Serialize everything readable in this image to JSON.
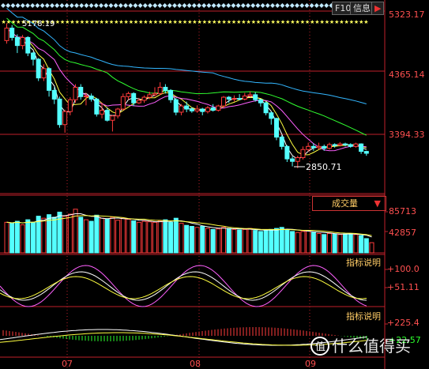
{
  "toolbar": {
    "f10_label": "F10",
    "info_label": "信息",
    "expand_icon": "expand-right-icon"
  },
  "price_axis": {
    "labels": [
      "5323.17",
      "4365.14",
      "3394.33"
    ]
  },
  "volume": {
    "title": "成交量",
    "axis_labels": [
      "85713",
      "42857"
    ]
  },
  "indicator1": {
    "label": "指标说明",
    "axis_labels": [
      "+100.0",
      "+51.11"
    ]
  },
  "indicator2": {
    "label": "指标说明",
    "axis_labels": [
      "+225.4",
      "+22.57"
    ]
  },
  "annotations": {
    "high_label": "5178.19",
    "low_label": "2850.71"
  },
  "time_axis": {
    "labels": [
      "07",
      "08",
      "09"
    ]
  },
  "watermark": {
    "text": "什么值得买"
  },
  "colors": {
    "up": "#ff3b3b",
    "down": "#54ffff",
    "border": "#c0202a",
    "ma_white": "#ffffff",
    "ma_yellow": "#ffff40",
    "ma_magenta": "#ff60ff",
    "ma_green": "#30ff30",
    "ma_cyan": "#33b6ff"
  },
  "chart_data": {
    "type": "candlestick",
    "price_scale": {
      "max": 5323.17,
      "mid": 4365.14,
      "low": 3394.33
    },
    "high_marker": 5178.19,
    "low_marker": 2850.71,
    "volume_scale": {
      "max": 85713,
      "mid": 42857
    },
    "indicator1_scale": {
      "max": 100.0,
      "mid": 51.11
    },
    "indicator2_scale": {
      "max": 225.4,
      "mid": 22.57
    },
    "candles": [
      {
        "o": 4900,
        "c": 5100,
        "h": 5178,
        "l": 4850
      },
      {
        "o": 5100,
        "c": 4950,
        "h": 5150,
        "l": 4900
      },
      {
        "o": 4950,
        "c": 4820,
        "h": 5000,
        "l": 4700
      },
      {
        "o": 4820,
        "c": 4950,
        "h": 4990,
        "l": 4760
      },
      {
        "o": 4950,
        "c": 4700,
        "h": 4970,
        "l": 4650
      },
      {
        "o": 4700,
        "c": 4600,
        "h": 4720,
        "l": 4500
      },
      {
        "o": 4600,
        "c": 4300,
        "h": 4620,
        "l": 4250
      },
      {
        "o": 4300,
        "c": 4450,
        "h": 4520,
        "l": 4250
      },
      {
        "o": 4450,
        "c": 4100,
        "h": 4470,
        "l": 4000
      },
      {
        "o": 4100,
        "c": 3960,
        "h": 4150,
        "l": 3880
      },
      {
        "o": 3960,
        "c": 3550,
        "h": 4000,
        "l": 3500
      },
      {
        "o": 3550,
        "c": 3760,
        "h": 3790,
        "l": 3420
      },
      {
        "o": 3760,
        "c": 3950,
        "h": 3990,
        "l": 3700
      },
      {
        "o": 3950,
        "c": 4150,
        "h": 4200,
        "l": 3900
      },
      {
        "o": 4150,
        "c": 4000,
        "h": 4200,
        "l": 3950
      },
      {
        "o": 4000,
        "c": 4010,
        "h": 4060,
        "l": 3860
      },
      {
        "o": 4010,
        "c": 3960,
        "h": 4050,
        "l": 3920
      },
      {
        "o": 3960,
        "c": 3720,
        "h": 3980,
        "l": 3680
      },
      {
        "o": 3720,
        "c": 3780,
        "h": 3900,
        "l": 3650
      },
      {
        "o": 3780,
        "c": 3620,
        "h": 3820,
        "l": 3600
      },
      {
        "o": 3620,
        "c": 3690,
        "h": 3700,
        "l": 3440
      },
      {
        "o": 3690,
        "c": 3800,
        "h": 3820,
        "l": 3650
      },
      {
        "o": 3800,
        "c": 4000,
        "h": 4050,
        "l": 3780
      },
      {
        "o": 4000,
        "c": 4050,
        "h": 4080,
        "l": 3950
      },
      {
        "o": 4050,
        "c": 3900,
        "h": 4070,
        "l": 3850
      },
      {
        "o": 3900,
        "c": 3940,
        "h": 3980,
        "l": 3880
      },
      {
        "o": 3940,
        "c": 3990,
        "h": 4020,
        "l": 3900
      },
      {
        "o": 3990,
        "c": 4030,
        "h": 4080,
        "l": 3960
      },
      {
        "o": 4030,
        "c": 4050,
        "h": 4150,
        "l": 4000
      },
      {
        "o": 4050,
        "c": 4150,
        "h": 4230,
        "l": 4020
      },
      {
        "o": 4150,
        "c": 4100,
        "h": 4200,
        "l": 4050
      },
      {
        "o": 4100,
        "c": 3950,
        "h": 4120,
        "l": 3900
      },
      {
        "o": 3950,
        "c": 3750,
        "h": 3980,
        "l": 3700
      },
      {
        "o": 3750,
        "c": 3850,
        "h": 3880,
        "l": 3700
      },
      {
        "o": 3850,
        "c": 3800,
        "h": 3920,
        "l": 3750
      },
      {
        "o": 3800,
        "c": 3770,
        "h": 3830,
        "l": 3740
      },
      {
        "o": 3770,
        "c": 3800,
        "h": 3860,
        "l": 3740
      },
      {
        "o": 3800,
        "c": 3760,
        "h": 3820,
        "l": 3700
      },
      {
        "o": 3760,
        "c": 3820,
        "h": 3850,
        "l": 3730
      },
      {
        "o": 3820,
        "c": 3780,
        "h": 3880,
        "l": 3760
      },
      {
        "o": 3780,
        "c": 3850,
        "h": 3870,
        "l": 3760
      },
      {
        "o": 3850,
        "c": 3990,
        "h": 4010,
        "l": 3820
      },
      {
        "o": 3990,
        "c": 3960,
        "h": 4010,
        "l": 3900
      },
      {
        "o": 3960,
        "c": 3970,
        "h": 4020,
        "l": 3920
      },
      {
        "o": 3970,
        "c": 3960,
        "h": 4040,
        "l": 3940
      },
      {
        "o": 3960,
        "c": 4010,
        "h": 4060,
        "l": 3940
      },
      {
        "o": 4010,
        "c": 4030,
        "h": 4080,
        "l": 3990
      },
      {
        "o": 4030,
        "c": 3950,
        "h": 4070,
        "l": 3920
      },
      {
        "o": 3950,
        "c": 3900,
        "h": 3960,
        "l": 3840
      },
      {
        "o": 3900,
        "c": 3740,
        "h": 3920,
        "l": 3700
      },
      {
        "o": 3740,
        "c": 3650,
        "h": 3760,
        "l": 3550
      },
      {
        "o": 3650,
        "c": 3350,
        "h": 3660,
        "l": 3300
      },
      {
        "o": 3350,
        "c": 3200,
        "h": 3380,
        "l": 3150
      },
      {
        "o": 3200,
        "c": 3000,
        "h": 3220,
        "l": 2950
      },
      {
        "o": 3000,
        "c": 2960,
        "h": 3040,
        "l": 2880
      },
      {
        "o": 2960,
        "c": 3020,
        "h": 3050,
        "l": 2850.71
      },
      {
        "o": 3020,
        "c": 3150,
        "h": 3200,
        "l": 2990
      },
      {
        "o": 3150,
        "c": 3200,
        "h": 3260,
        "l": 3120
      },
      {
        "o": 3200,
        "c": 3180,
        "h": 3250,
        "l": 3130
      },
      {
        "o": 3180,
        "c": 3200,
        "h": 3260,
        "l": 3150
      },
      {
        "o": 3200,
        "c": 3170,
        "h": 3230,
        "l": 3130
      },
      {
        "o": 3170,
        "c": 3230,
        "h": 3260,
        "l": 3150
      },
      {
        "o": 3230,
        "c": 3220,
        "h": 3250,
        "l": 3180
      },
      {
        "o": 3220,
        "c": 3240,
        "h": 3270,
        "l": 3200
      },
      {
        "o": 3240,
        "c": 3230,
        "h": 3260,
        "l": 3200
      },
      {
        "o": 3230,
        "c": 3200,
        "h": 3250,
        "l": 3180
      },
      {
        "o": 3200,
        "c": 3240,
        "h": 3260,
        "l": 3180
      },
      {
        "o": 3240,
        "c": 3120,
        "h": 3250,
        "l": 3080
      },
      {
        "o": 3120,
        "c": 3090,
        "h": 3130,
        "l": 3050
      }
    ],
    "volumes": [
      60000,
      58000,
      62000,
      55000,
      65000,
      60000,
      72000,
      68000,
      75000,
      70000,
      80000,
      72000,
      76000,
      85713,
      70000,
      65000,
      62000,
      74000,
      68000,
      66000,
      70000,
      64000,
      68000,
      66000,
      63000,
      60000,
      62000,
      61000,
      60000,
      63000,
      65000,
      60000,
      68000,
      58000,
      54000,
      52000,
      50000,
      52000,
      48000,
      46000,
      47000,
      50000,
      48000,
      46000,
      45000,
      46000,
      48000,
      44000,
      42000,
      44000,
      46000,
      48000,
      50000,
      45000,
      42000,
      40000,
      42000,
      44000,
      40000,
      38000,
      36000,
      38000,
      37000,
      36000,
      37000,
      38000,
      36000,
      34000,
      28000,
      20000
    ],
    "x_axis_labels": [
      "07",
      "08",
      "09"
    ]
  }
}
